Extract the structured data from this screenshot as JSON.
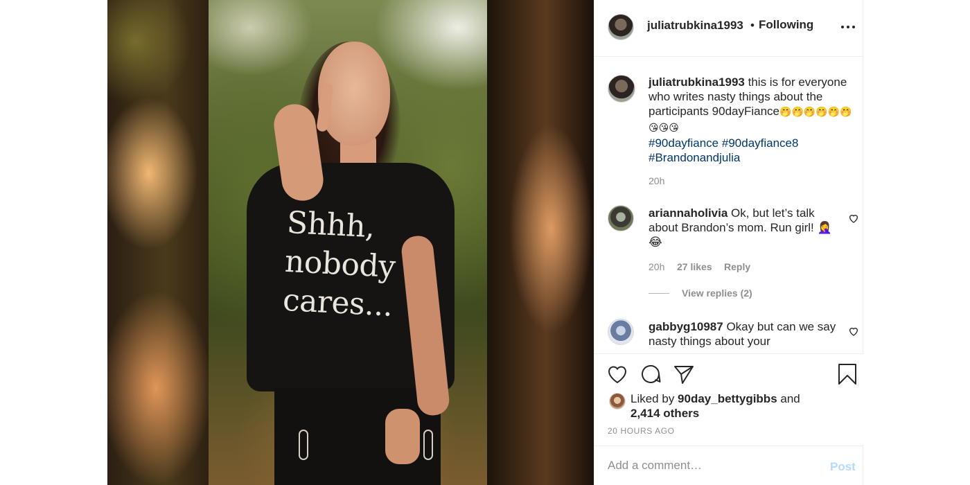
{
  "post": {
    "username": "juliatrubkina1993",
    "follow_separator": "•",
    "follow_status": "Following",
    "shirt_text": [
      "Shhh,",
      "nobody",
      "cares..."
    ]
  },
  "caption": {
    "username": "juliatrubkina1993",
    "text": " this is for everyone who writes nasty things about the participants 90dayFiance",
    "emojis_line1": "🤭🤭🤭🤭🤭🤭",
    "emojis_line2": "😘😘😘",
    "hashtags": [
      "#90dayfiance",
      "#90dayfiance8",
      "#Brandonandjulia"
    ],
    "time": "20h"
  },
  "comments": [
    {
      "username": "ariannaholivia",
      "text": " Ok, but let’s talk about Brandon’s mom. Run girl! 🤦‍♀️ 😂",
      "time": "20h",
      "likes": "27 likes",
      "reply_label": "Reply",
      "view_replies": "View replies (2)"
    },
    {
      "username": "gabbyg10987",
      "text": " Okay but can we say nasty things about your"
    }
  ],
  "likes": {
    "prefix": "Liked by ",
    "user": "90day_bettygibbs",
    "middle": " and",
    "others": "2,414 others"
  },
  "timestamp": "20 HOURS AGO",
  "add_comment": {
    "placeholder": "Add a comment…",
    "post_label": "Post"
  },
  "icons": {
    "more": "more-horizontal-icon",
    "like": "heart-icon",
    "comment": "comment-bubble-icon",
    "share": "paper-plane-icon",
    "save": "bookmark-icon"
  },
  "colors": {
    "text": "#262626",
    "muted": "#8e8e8e",
    "hashtag": "#00376b",
    "post_disabled": "#b3dbff",
    "border": "#efefef"
  }
}
